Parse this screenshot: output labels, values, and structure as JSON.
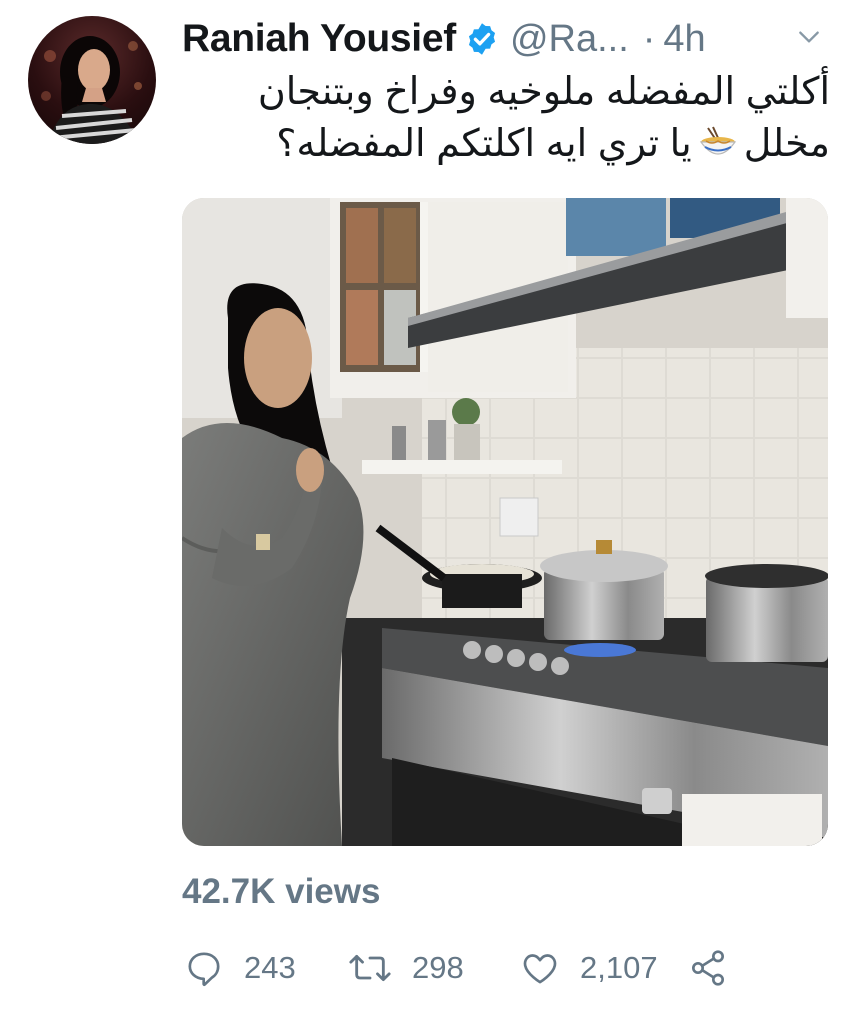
{
  "user": {
    "display_name": "Raniah Yousief",
    "handle": "@Ra...",
    "separator": "·",
    "time": "4h",
    "verified": true
  },
  "tweet": {
    "line1": "أكلتي المفضله ملوخيه وفراخ وبتنجان",
    "line2_before_emoji": "مخلل",
    "emoji": "noodle-bowl-emoji",
    "line2_after_emoji": "يا تري ايه اكلتكم المفضله؟"
  },
  "media": {
    "type": "video",
    "description_icon": "video-thumbnail"
  },
  "stats": {
    "views": "42.7K views"
  },
  "actions": {
    "reply_count": "243",
    "retweet_count": "298",
    "like_count": "2,107"
  },
  "colors": {
    "text": "#14171a",
    "secondary": "#657786",
    "verified_blue": "#1da1f2"
  },
  "icons": [
    "reply-icon",
    "retweet-icon",
    "like-icon",
    "share-icon",
    "verified-badge-icon",
    "caret-down-icon"
  ]
}
